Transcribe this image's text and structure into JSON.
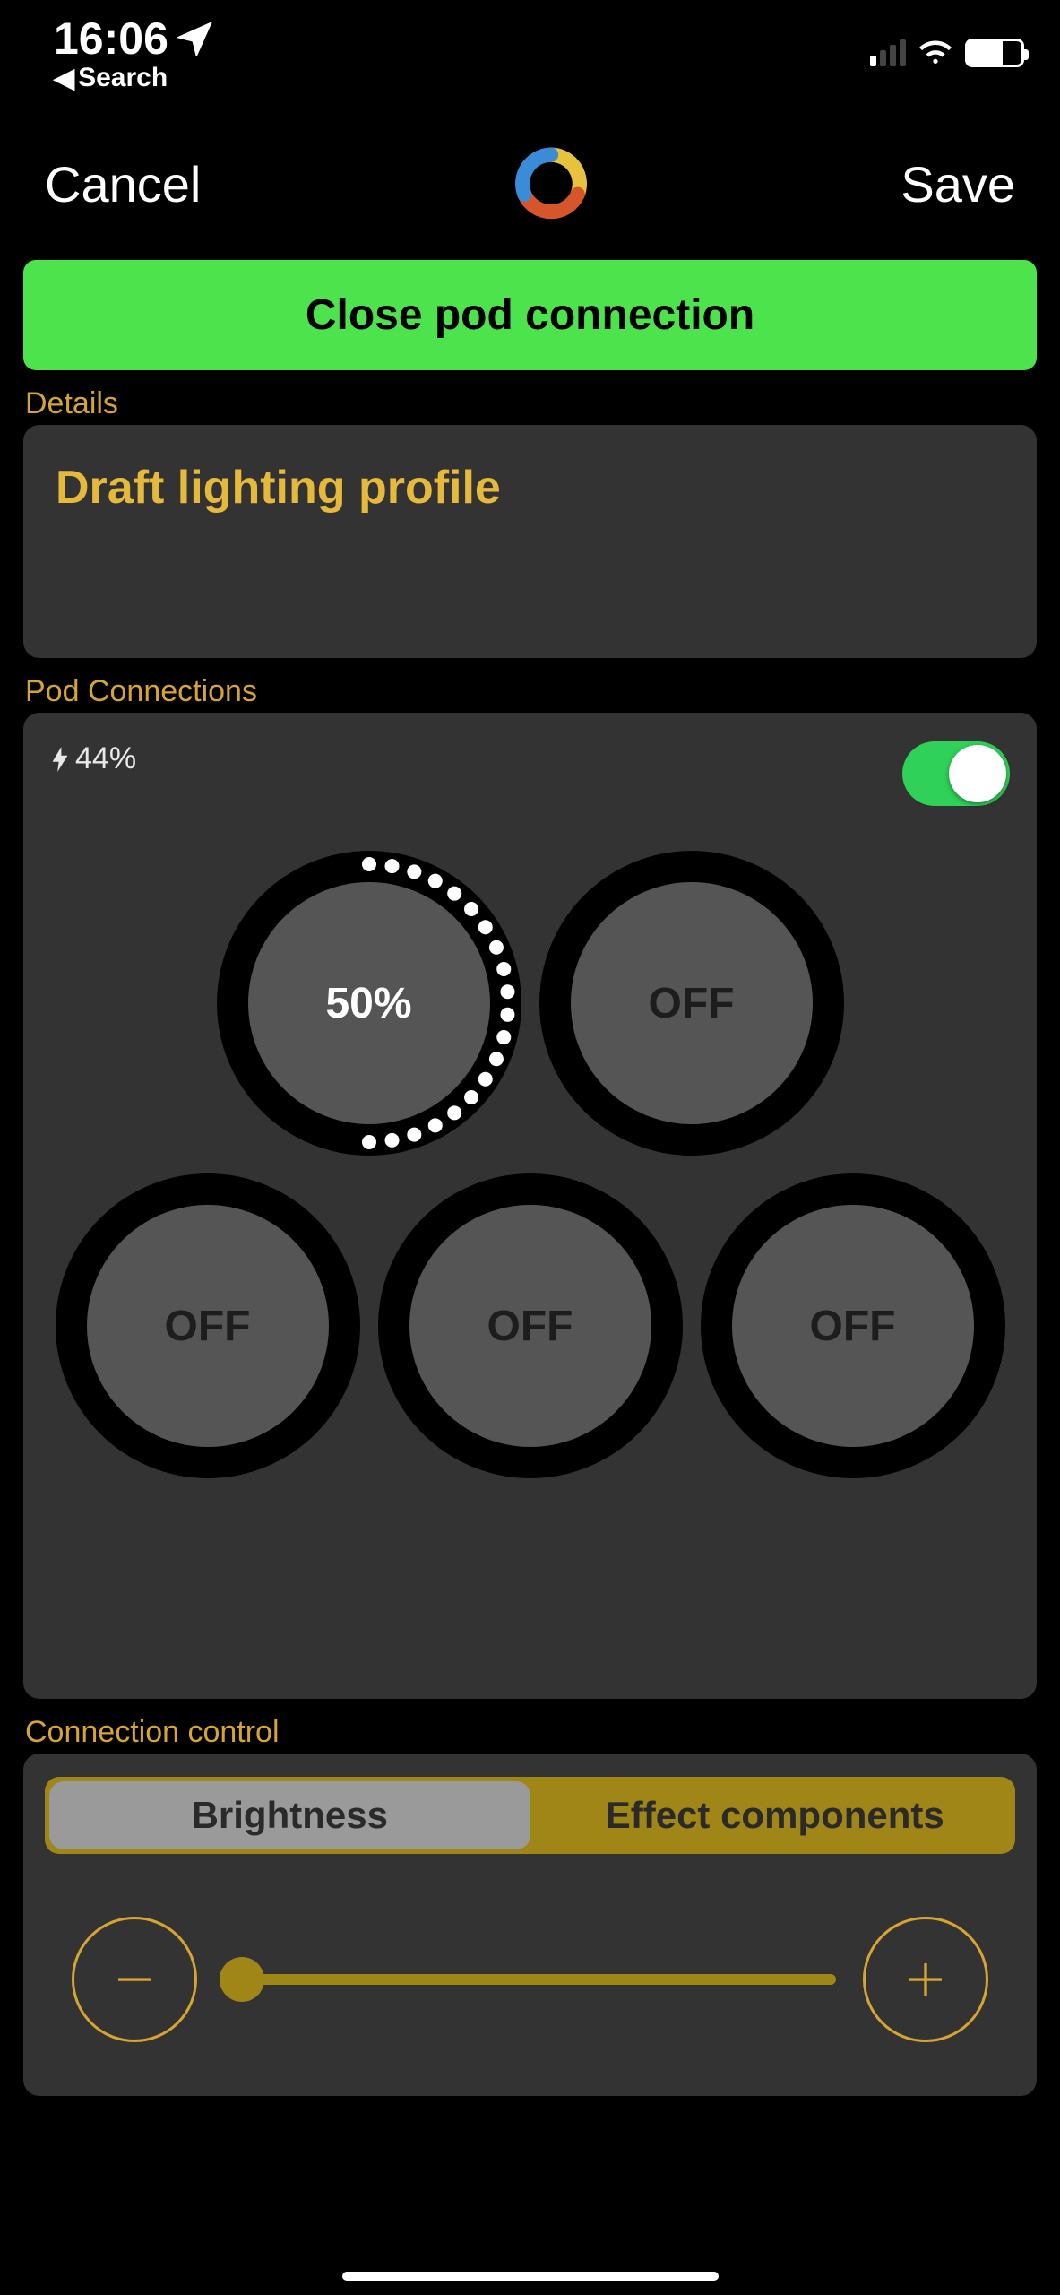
{
  "status": {
    "time": "16:06",
    "back_label": "Search"
  },
  "nav": {
    "cancel": "Cancel",
    "save": "Save"
  },
  "buttons": {
    "close_pod": "Close pod connection"
  },
  "sections": {
    "details": "Details",
    "pod_connections": "Pod Connections",
    "connection_control": "Connection control"
  },
  "details": {
    "profile_name": "Draft lighting profile"
  },
  "pod": {
    "battery_pct": "44%",
    "dials": {
      "d1": "50%",
      "d2": "OFF",
      "d3": "OFF",
      "d4": "OFF",
      "d5": "OFF"
    }
  },
  "control": {
    "tabs": {
      "brightness": "Brightness",
      "effect": "Effect components"
    },
    "slider_value_pct": 3
  },
  "colors": {
    "accent_gold": "#d6a531",
    "green_btn": "#4de34d",
    "toggle_green": "#2fd158"
  }
}
